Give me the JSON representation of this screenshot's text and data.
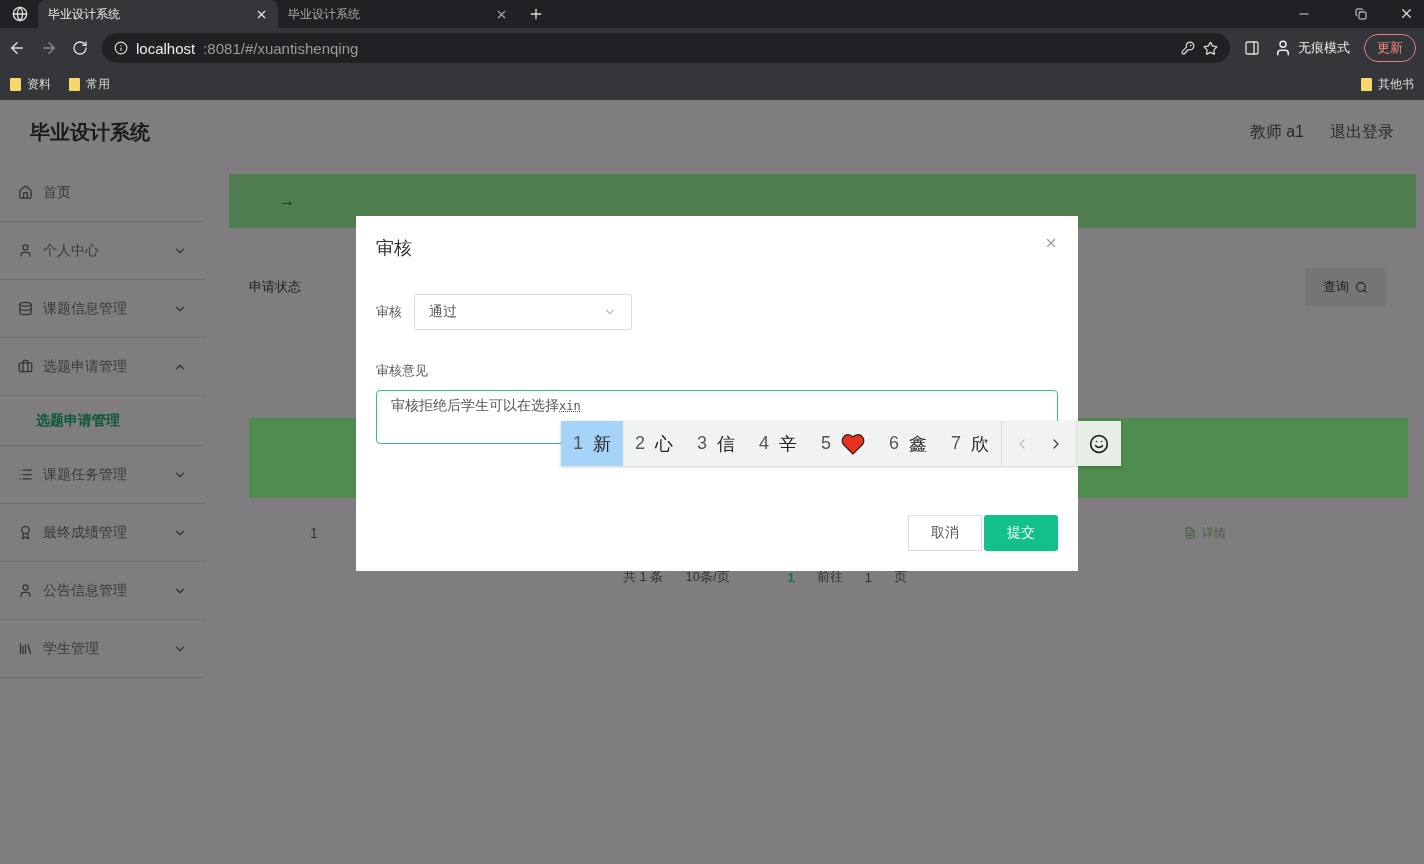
{
  "browser": {
    "tabs": [
      {
        "title": "毕业设计系统",
        "selected": true
      },
      {
        "title": "毕业设计系统",
        "selected": false
      }
    ],
    "url": {
      "host": "localhost",
      "path": ":8081/#/xuantishenqing"
    },
    "incognito": "无痕模式",
    "update": "更新",
    "bookmarks": [
      "资料",
      "常用"
    ],
    "other_bookmarks": "其他书"
  },
  "app": {
    "title": "毕业设计系统",
    "user": "教师 a1",
    "logout": "退出登录"
  },
  "sidebar": {
    "items": [
      {
        "label": "首页",
        "kind": "link"
      },
      {
        "label": "个人中心",
        "kind": "menu",
        "expanded": false
      },
      {
        "label": "课题信息管理",
        "kind": "menu",
        "expanded": false
      },
      {
        "label": "选题申请管理",
        "kind": "menu",
        "expanded": true,
        "children": [
          {
            "label": "选题申请管理",
            "selected": true
          }
        ]
      },
      {
        "label": "课题任务管理",
        "kind": "menu",
        "expanded": false
      },
      {
        "label": "最终成绩管理",
        "kind": "menu",
        "expanded": false
      },
      {
        "label": "公告信息管理",
        "kind": "menu",
        "expanded": false
      },
      {
        "label": "学生管理",
        "kind": "menu",
        "expanded": false
      }
    ]
  },
  "breadcrumb": {
    "arrow": "→"
  },
  "search": {
    "label": "申请状态",
    "button": "查询"
  },
  "table": {
    "rows": [
      {
        "index": "1",
        "action": "详情"
      }
    ]
  },
  "pagination": {
    "total": "共 1 条",
    "page_size": "10条/页",
    "current": "1",
    "goto": "前往",
    "goto_value": "1",
    "unit": "页"
  },
  "dialog": {
    "title": "审核",
    "select": {
      "label": "审核",
      "value": "通过"
    },
    "textarea": {
      "label": "审核意见",
      "value": "审核拒绝后学生可以在选择",
      "composing": "xin"
    },
    "cancel": "取消",
    "submit": "提交"
  },
  "ime": {
    "candidates": [
      {
        "num": "1",
        "kind": "text",
        "text": "新",
        "selected": true
      },
      {
        "num": "2",
        "kind": "text",
        "text": "心",
        "selected": false
      },
      {
        "num": "3",
        "kind": "text",
        "text": "信",
        "selected": false
      },
      {
        "num": "4",
        "kind": "text",
        "text": "辛",
        "selected": false
      },
      {
        "num": "5",
        "kind": "heart",
        "selected": false
      },
      {
        "num": "6",
        "kind": "text",
        "text": "鑫",
        "selected": false
      },
      {
        "num": "7",
        "kind": "text",
        "text": "欣",
        "selected": false
      }
    ]
  }
}
